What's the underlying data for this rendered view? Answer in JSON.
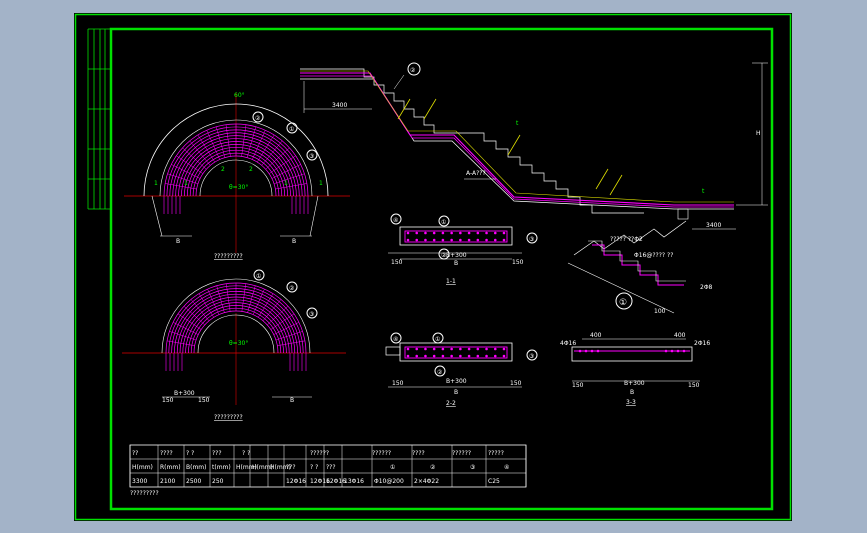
{
  "colors": {
    "background_outer": "#a3b3c8",
    "sheet": "#000000",
    "border": "#00e000",
    "rebar": "#ff00ff",
    "red_line": "#e00000",
    "text": "#ffffff",
    "green_text": "#00ff00",
    "yellow": "#e0e000"
  },
  "section_aa": {
    "title": "A-A???",
    "dim_left": "3400",
    "dim_right": "3400",
    "dim_h": "H",
    "callout": "②",
    "slab_label_1": "t",
    "slab_label_2": "t"
  },
  "plan_top": {
    "caption": "?????????",
    "angle_top": "60°",
    "angle_center": "θ=30°",
    "callouts": [
      "①",
      "②",
      "③"
    ],
    "dim_left": "B",
    "dim_right": "B",
    "side_labels": [
      "1",
      "1",
      "1",
      "1",
      "2",
      "2"
    ]
  },
  "plan_bottom": {
    "caption": "?????????",
    "angle_center": "θ=30°",
    "callouts": [
      "①",
      "②",
      "③"
    ],
    "dim_left": "B+300",
    "dim_sub_left": "150",
    "dim_sub_right": "150",
    "dim_right": "B"
  },
  "section_11": {
    "caption": "1-1",
    "callouts": [
      "④",
      "①",
      "③",
      "②"
    ],
    "dim_total": "B",
    "dim_mid": "B+300",
    "dim_left": "150",
    "dim_right": "150"
  },
  "section_22": {
    "caption": "2-2",
    "callouts": [
      "④",
      "①",
      "③",
      "②"
    ],
    "dim_total": "B",
    "dim_mid": "B+300",
    "dim_left": "150",
    "dim_right": "150"
  },
  "section_33": {
    "caption": "3-3",
    "dim_top_left": "400",
    "dim_top_right": "400",
    "label_left": "4Φ16",
    "label_right": "2Φ16",
    "dim_total": "B",
    "dim_mid": "B+300",
    "dim_left": "150",
    "dim_right": "150"
  },
  "detail_step": {
    "note": "????? ??Φ2",
    "note2": "Φ16@???? ??",
    "callout": "①",
    "dim": "100",
    "right": "2Φ8"
  },
  "schedule": {
    "headers_row1": [
      "??",
      "????",
      "? ?",
      "???",
      "? ?",
      "??????",
      "??????",
      "????",
      "??????",
      "?????"
    ],
    "headers_row1_circles": [
      "",
      "",
      "",
      "",
      "",
      "①",
      "②",
      "③",
      "④",
      ""
    ],
    "headers_row2": [
      "H(mm)",
      "R(mm)",
      "B(mm)",
      "t(mm)",
      "H(mm)",
      "H(mm)",
      "H(mm)",
      "???",
      "? ?",
      "???"
    ],
    "values": [
      "3300",
      "2100",
      "2500",
      "250",
      "",
      "",
      "",
      "12Φ16",
      "12Φ16",
      "12Φ16",
      "13Φ16",
      "Φ10@200",
      "2×4Φ22",
      "C25"
    ],
    "footer": "?????????"
  }
}
